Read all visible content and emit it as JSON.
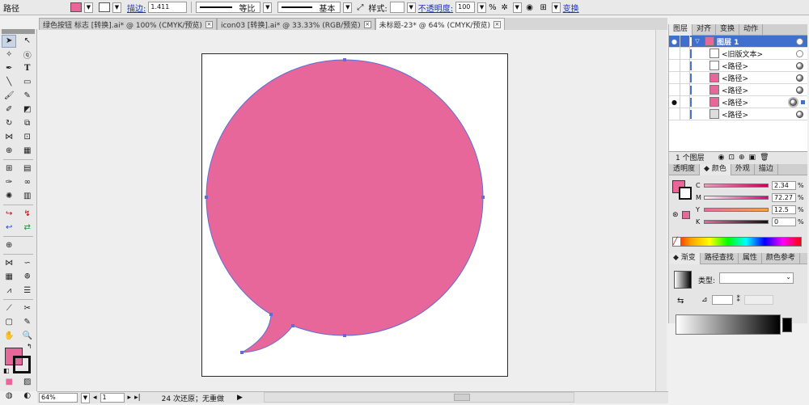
{
  "control_bar": {
    "object_type": "路径",
    "stroke_label": "描边:",
    "stroke_weight": "1.411",
    "profile_label": "等比",
    "brush_label": "基本",
    "style_label": "样式:",
    "opacity_label": "不透明度:",
    "opacity_value": "100",
    "opacity_unit": "%",
    "transform_label": "变换",
    "fill_color": "#e8679a"
  },
  "tabs": [
    {
      "label": "绿色按钮 标志 [转换].ai* @ 100% (CMYK/预览)",
      "active": false
    },
    {
      "label": "icon03 [转换].ai* @ 33.33% (RGB/预览)",
      "active": false
    },
    {
      "label": "未标题-23* @ 64% (CMYK/预览)",
      "active": true
    }
  ],
  "status_bar": {
    "zoom": "64%",
    "page": "1",
    "history": "24 次还原；无重做"
  },
  "layers_panel": {
    "tabs": [
      "图层",
      "对齐",
      "变换",
      "动作"
    ],
    "rows": [
      {
        "name": "图层 1",
        "level": 0
      },
      {
        "name": "<旧版文本>",
        "level": 1
      },
      {
        "name": "<路径>",
        "level": 1
      },
      {
        "name": "<路径>",
        "level": 1
      },
      {
        "name": "<路径>",
        "level": 1
      },
      {
        "name": "<路径>",
        "level": 1
      },
      {
        "name": "<路径>",
        "level": 1
      }
    ],
    "footer": "1 个图层"
  },
  "color_panel": {
    "tabs": [
      "透明度",
      "颜色",
      "外观",
      "描边"
    ],
    "fill": "#e8679a",
    "channels": [
      {
        "name": "C",
        "value": "2.34",
        "fraction": 0.0234,
        "gradient": [
          "#ffffff",
          "#1aaee8"
        ]
      },
      {
        "name": "M",
        "value": "72.27",
        "fraction": 0.7227,
        "gradient": [
          "#ffffff",
          "#e6007e"
        ]
      },
      {
        "name": "Y",
        "value": "12.5",
        "fraction": 0.125,
        "gradient": [
          "#ffffff",
          "#ffee00"
        ]
      },
      {
        "name": "K",
        "value": "0",
        "fraction": 0,
        "gradient": [
          "#ffffff",
          "#000000"
        ]
      }
    ],
    "unit": "%"
  },
  "gradient_panel": {
    "tabs": [
      "渐变",
      "路径查找",
      "属性",
      "颜色参考"
    ],
    "type_label": "类型:"
  },
  "artwork": {
    "fill": "#e8679a",
    "selection_color": "#5b6fd6"
  }
}
